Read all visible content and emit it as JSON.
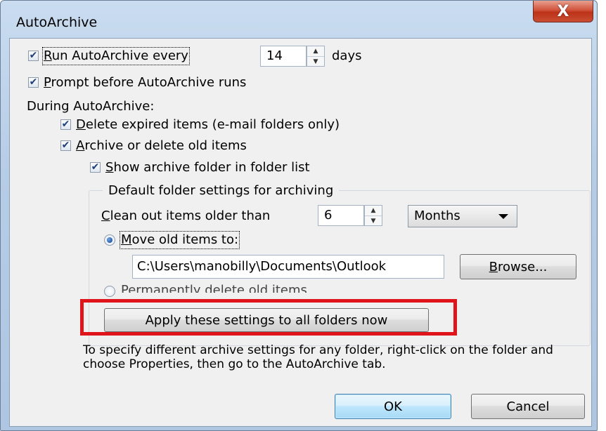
{
  "window": {
    "title": "AutoArchive",
    "close_glyph": "X"
  },
  "run_autoarchive": {
    "checked": true,
    "label_prefix_mnemonic": "R",
    "label_rest": "un AutoArchive every",
    "days_value": "14",
    "days_unit": "days"
  },
  "prompt_before": {
    "checked": true,
    "mnemonic": "P",
    "label_rest": "rompt before AutoArchive runs"
  },
  "during_label": "During AutoArchive:",
  "delete_expired": {
    "checked": true,
    "mnemonic": "D",
    "label_rest": "elete expired items (e-mail folders only)"
  },
  "archive_old": {
    "checked": true,
    "mnemonic": "A",
    "label_rest": "rchive or delete old items"
  },
  "show_archive_folder": {
    "checked": true,
    "mnemonic": "S",
    "label_rest": "how archive folder in folder list"
  },
  "default_group": {
    "title": "Default folder settings for archiving",
    "clean_out": {
      "mnemonic": "C",
      "label_rest": "lean out items older than",
      "value": "6",
      "unit": "Months"
    },
    "move_old": {
      "selected": true,
      "mnemonic": "M",
      "label_rest": "ove old items to:"
    },
    "path_value": "C:\\Users\\manobilly\\Documents\\Outlook",
    "browse": {
      "mnemonic": "B",
      "label_rest": "rowse..."
    },
    "permanently_delete": {
      "selected": false,
      "label": "Permanently delete old items"
    },
    "apply_button": "Apply these settings to all folders now"
  },
  "info_text": "To specify different archive settings for any folder, right-click on the folder and choose Properties, then go to the AutoArchive tab.",
  "buttons": {
    "ok": "OK",
    "cancel": "Cancel"
  },
  "colors": {
    "highlight_box": "#e0151b",
    "dialog_bg": "#f0f0f0",
    "close_button": "#c94e33"
  },
  "icons": {
    "checkbox": "check-mark",
    "spin": "spin-up-down-arrows",
    "combo": "chevron-down-icon",
    "close": "close-icon"
  }
}
